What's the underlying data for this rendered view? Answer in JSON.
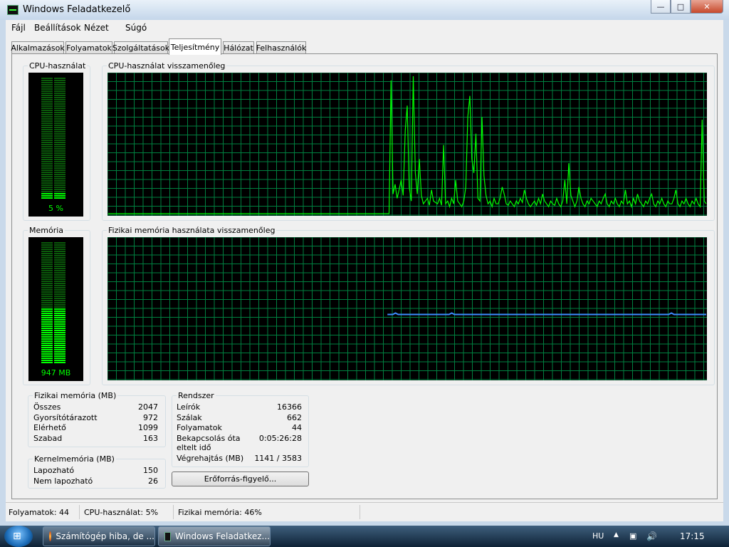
{
  "window": {
    "title": "Windows Feladatkezelő"
  },
  "menu": [
    "Fájl",
    "Beállítások",
    "Nézet",
    "Súgó"
  ],
  "tabs": [
    "Alkalmazások",
    "Folyamatok",
    "Szolgáltatások",
    "Teljesítmény",
    "Hálózat",
    "Felhasználók"
  ],
  "active_tab": 3,
  "cpu": {
    "label": "CPU-használat",
    "value_text": "5 %",
    "level": 0.05,
    "history_label": "CPU-használat visszamenőleg"
  },
  "memory": {
    "label": "Memória",
    "value_text": "947 MB",
    "level": 0.46,
    "history_label": "Fizikai memória használata visszamenőleg"
  },
  "physical": {
    "label": "Fizikai memória (MB)",
    "rows": [
      {
        "name": "Összes",
        "value": "2047"
      },
      {
        "name": "Gyorsítótárazott",
        "value": "972"
      },
      {
        "name": "Elérhető",
        "value": "1099"
      },
      {
        "name": "Szabad",
        "value": "163"
      }
    ]
  },
  "kernel": {
    "label": "Kernelmemória (MB)",
    "rows": [
      {
        "name": "Lapozható",
        "value": "150"
      },
      {
        "name": "Nem lapozható",
        "value": "26"
      }
    ]
  },
  "system": {
    "label": "Rendszer",
    "rows": [
      {
        "name": "Leírók",
        "value": "16366"
      },
      {
        "name": "Szálak",
        "value": "662"
      },
      {
        "name": "Folyamatok",
        "value": "44"
      },
      {
        "name": "Bekapcsolás óta\neltelt idő",
        "value": "0:05:26:28"
      },
      {
        "name": "Végrehajtás (MB)",
        "value": "1141 / 3583"
      }
    ]
  },
  "resource_button": "Erőforrás-figyelő...",
  "status": {
    "processes": "Folyamatok: 44",
    "cpu": "CPU-használat: 5%",
    "memory": "Fizikai memória: 46%"
  },
  "taskbar": {
    "items": [
      {
        "label": "Számítógép hiba, de ...",
        "icon": "firefox-icon"
      },
      {
        "label": "Windows Feladatkez...",
        "icon": "task-manager-icon"
      }
    ],
    "lang": "HU",
    "clock": "17:15"
  },
  "colors": {
    "cpu_line": "#00ff00",
    "memory_line": "#3c8cff",
    "grid": "#008040",
    "meter_on": "#00ff00",
    "meter_off": "#0a5a0a"
  },
  "chart_data": [
    {
      "type": "line",
      "title": "CPU-használat visszamenőleg",
      "ylim": [
        0,
        100
      ],
      "x": [
        0,
        1,
        2,
        3,
        4,
        5,
        6,
        7,
        8,
        9,
        10,
        11,
        12,
        13,
        14,
        15,
        16,
        17,
        18,
        19,
        20,
        21,
        22,
        23,
        24,
        25,
        26,
        27,
        28,
        29,
        30,
        31,
        32,
        33,
        34,
        35,
        36,
        37,
        38,
        39,
        40,
        41,
        42,
        43,
        44,
        45,
        46,
        47,
        48,
        49,
        50,
        51,
        52,
        53,
        54,
        55,
        56,
        57,
        58,
        59,
        60,
        61,
        62,
        63,
        64,
        65,
        66,
        67,
        68,
        69,
        70,
        71,
        72,
        73,
        74,
        75,
        76,
        77,
        78,
        79,
        80,
        81,
        82,
        83,
        84,
        85,
        86,
        87,
        88,
        89,
        90,
        91,
        92,
        93,
        94,
        95,
        96,
        97,
        98,
        99,
        100,
        101,
        102,
        103,
        104,
        105,
        106,
        107,
        108,
        109,
        110,
        111,
        112,
        113,
        114,
        115,
        116,
        117,
        118,
        119,
        120,
        121,
        122,
        123,
        124,
        125,
        126,
        127,
        128,
        129,
        130,
        131,
        132,
        133,
        134,
        135,
        136,
        137,
        138,
        139,
        140,
        141,
        142,
        143,
        144,
        145,
        146,
        147,
        148,
        149,
        150,
        151,
        152,
        153,
        154,
        155,
        156,
        157,
        158,
        159,
        160,
        161,
        162,
        163,
        164,
        165,
        166,
        167,
        168,
        169,
        170,
        171,
        172,
        173,
        174,
        175,
        176,
        177,
        178,
        179,
        180,
        181,
        182,
        183,
        184,
        185,
        186,
        187,
        188,
        189,
        190,
        191,
        192,
        193,
        194,
        195,
        196,
        197,
        198,
        199,
        200,
        201,
        202,
        203,
        204,
        205,
        206,
        207,
        208,
        209,
        210,
        211,
        212,
        213,
        214,
        215,
        216,
        217,
        218,
        219,
        220,
        221,
        222,
        223,
        224,
        225,
        226,
        227,
        228,
        229,
        230,
        231,
        232,
        233,
        234,
        235,
        236,
        237,
        238,
        239,
        240,
        241,
        242,
        243,
        244,
        245,
        246,
        247,
        248,
        249,
        250,
        251,
        252,
        253,
        254,
        255,
        256,
        257,
        258,
        259,
        260,
        261,
        262,
        263,
        264,
        265,
        266,
        267,
        268,
        269,
        270,
        271,
        272,
        273,
        274,
        275,
        276,
        277,
        278,
        279,
        280,
        281,
        282,
        283,
        284,
        285,
        286,
        287,
        288,
        289,
        290,
        291,
        292,
        293,
        294,
        295,
        296,
        297,
        298,
        299
      ],
      "series": [
        {
          "values": [
            1,
            1,
            1,
            1,
            1,
            1,
            1,
            1,
            1,
            1,
            1,
            1,
            1,
            1,
            1,
            1,
            1,
            1,
            1,
            1,
            1,
            1,
            1,
            1,
            1,
            1,
            1,
            1,
            1,
            1,
            1,
            1,
            1,
            1,
            1,
            1,
            1,
            1,
            1,
            1,
            1,
            1,
            1,
            1,
            1,
            1,
            1,
            1,
            1,
            1,
            1,
            1,
            1,
            1,
            1,
            1,
            1,
            1,
            1,
            1,
            1,
            1,
            1,
            1,
            1,
            1,
            1,
            1,
            1,
            1,
            1,
            1,
            1,
            1,
            1,
            1,
            1,
            1,
            1,
            1,
            1,
            1,
            1,
            1,
            1,
            1,
            1,
            1,
            1,
            1,
            1,
            1,
            1,
            1,
            1,
            1,
            1,
            1,
            1,
            1,
            1,
            1,
            1,
            1,
            1,
            1,
            1,
            1,
            1,
            1,
            1,
            1,
            1,
            1,
            1,
            1,
            1,
            1,
            1,
            1,
            1,
            1,
            1,
            1,
            1,
            1,
            1,
            1,
            1,
            1,
            1,
            1,
            1,
            1,
            1,
            1,
            1,
            1,
            1,
            1,
            96,
            15,
            22,
            12,
            18,
            25,
            14,
            60,
            78,
            20,
            10,
            99,
            30,
            15,
            40,
            14,
            8,
            10,
            12,
            7,
            18,
            10,
            9,
            8,
            12,
            7,
            50,
            8,
            10,
            6,
            12,
            8,
            25,
            10,
            8,
            6,
            10,
            20,
            70,
            85,
            40,
            30,
            58,
            12,
            10,
            70,
            28,
            14,
            8,
            10,
            6,
            12,
            8,
            8,
            12,
            20,
            15,
            8,
            7,
            10,
            8,
            6,
            10,
            8,
            12,
            9,
            18,
            12,
            8,
            6,
            8,
            10,
            7,
            12,
            8,
            15,
            10,
            8,
            6,
            10,
            8,
            7,
            12,
            8,
            6,
            10,
            25,
            8,
            37,
            14,
            10,
            6,
            10,
            20,
            12,
            8,
            6,
            10,
            8,
            12,
            10,
            8,
            6,
            10,
            8,
            12,
            15,
            8,
            6,
            10,
            8,
            12,
            8,
            6,
            10,
            8,
            18,
            8,
            10,
            6,
            12,
            8,
            15,
            10,
            8,
            6,
            10,
            8,
            12,
            15,
            8,
            6,
            10,
            8,
            12,
            8,
            6,
            10,
            8,
            8,
            12,
            18,
            8,
            6,
            10,
            8,
            12,
            8,
            6,
            10,
            8,
            12,
            8,
            6,
            68,
            10,
            8
          ]
        }
      ]
    },
    {
      "type": "line",
      "title": "Fizikai memória használata visszamenőleg",
      "ylim": [
        0,
        100
      ],
      "series": [
        {
          "values": [
            46,
            46,
            46,
            47,
            46,
            46,
            46,
            46,
            46,
            46,
            46,
            46,
            46,
            46,
            46,
            46,
            46,
            46,
            46,
            46,
            46,
            46,
            46,
            46,
            47,
            46,
            46,
            46,
            46,
            46,
            46,
            46,
            46,
            46,
            46,
            46,
            46,
            46,
            46,
            46,
            46,
            46,
            46,
            46,
            46,
            46,
            46,
            46,
            46,
            46,
            46,
            46,
            46,
            46,
            46,
            46,
            46,
            46,
            46,
            46,
            46,
            46,
            46,
            46,
            46,
            46,
            46,
            46,
            46,
            46,
            46,
            46,
            46,
            46,
            46,
            46,
            46,
            46,
            46,
            46,
            46,
            46,
            46,
            46,
            46,
            46,
            46,
            46,
            46,
            46,
            46,
            46,
            46,
            46,
            46,
            46,
            46,
            46,
            46,
            46,
            46,
            46,
            46,
            46,
            46,
            46,
            47,
            46,
            46,
            46,
            46,
            46,
            46,
            46,
            46,
            46,
            46,
            46,
            46,
            46
          ]
        }
      ],
      "start_fraction": 0.467
    }
  ]
}
